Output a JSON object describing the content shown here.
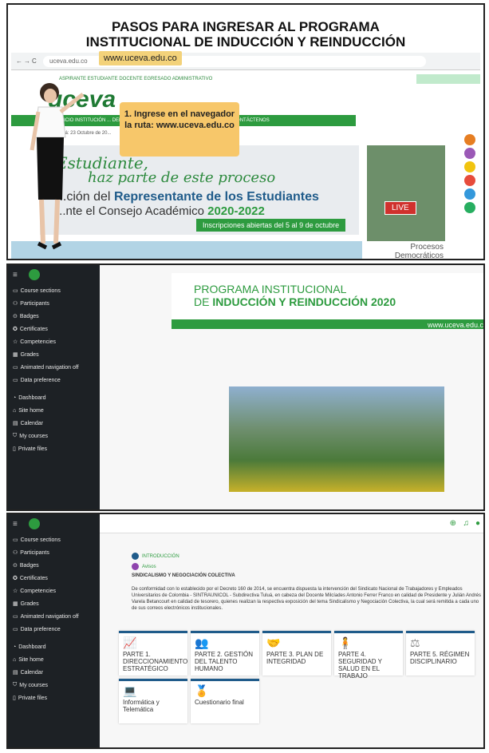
{
  "p1": {
    "title_line1": "PASOS PARA INGRESAR AL PROGRAMA",
    "title_line2": "INSTITUCIONAL DE  INDUCCIÓN Y REINDUCCIÓN",
    "url_small": "uceva.edu.co",
    "url_highlight": "www.uceva.edu.co",
    "top_links": "ASPIRANTE   ESTUDIANTE   DOCENTE   EGRESADO   ADMINISTRATIVO",
    "logo": "uceva",
    "nav_items": "INICIO   INSTITUCIÓN   ...   DEMOCRACIA   SERVICIOS   TRANSPARENCIA   PQRSD   CONTÁCTENOS",
    "callout": "1. Ingrese en el navegador la ruta: www.uceva.edu.co",
    "banner_script1": "Estudiante,",
    "banner_script2": "haz parte de este proceso",
    "banner_line1_a": "...ción del ",
    "banner_line1_b": "Representante de los Estudiantes",
    "banner_line2_a": "...nte el Consejo Académico ",
    "banner_line2_b": "2020-2022",
    "banner_inscr": "Inscripciones abiertas del 5 al 9 de octubre",
    "live": "LIVE",
    "procesos": "Procesos Democráticos",
    "date": "Tuluá: 23 Octubre de 20..."
  },
  "sidebar": {
    "items": [
      "Course sections",
      "Participants",
      "Badges",
      "Certificates",
      "Competencies",
      "Grades",
      "Animated navigation off",
      "Data preference",
      "Dashboard",
      "Site home",
      "Calendar",
      "My courses",
      "Private files"
    ]
  },
  "p2": {
    "title1": "PROGRAMA INSTITUCIONAL",
    "title2_a": "DE ",
    "title2_b": "INDUCCIÓN Y REINDUCCIÓN 2020",
    "site": "www.uceva.edu.co"
  },
  "p3": {
    "intro": "INTRODUCCIÓN",
    "avisos": "Avisos",
    "heading": "SINDICALISMO Y NEGOCIACIÓN COLECTIVA",
    "paragraph": "De conformidad con lo establecido por el Decreto 160 de 2014, se encuentra dispuesta la intervención del Sindicato Nacional de Trabajadores y Empleados Universitarios de Colombia - SINTRAUNICOL - Subdirectiva Tuluá, en cabeza del Docente Milcíades Antonio Ferrer Franco en calidad de Presidente y Julián Andrés Varela Betancourt en calidad de tesorero, quienes realizan la respectiva exposición del tema Sindicalismo y Negociación Colectiva, la cual será remitida a cada uno de sus correos electrónicos institucionales.",
    "tiles": [
      {
        "icon": "chart-icon",
        "glyph": "📈",
        "label": "PARTE 1. DIRECCIONAMIENTO ESTRATÉGICO"
      },
      {
        "icon": "people-icon",
        "glyph": "👥",
        "label": "PARTE 2. GESTIÓN DEL TALENTO HUMANO"
      },
      {
        "icon": "handshake-icon",
        "glyph": "🤝",
        "label": "PARTE 3. PLAN DE INTEGRIDAD"
      },
      {
        "icon": "worker-icon",
        "glyph": "🧍",
        "label": "PARTE 4. SEGURIDAD Y SALUD EN EL TRABAJO"
      },
      {
        "icon": "scales-icon",
        "glyph": "⚖",
        "label": "PARTE 5. RÉGIMEN DISCIPLINARIO"
      },
      {
        "icon": "laptop-icon",
        "glyph": "💻",
        "label": "Informática y Telemática"
      },
      {
        "icon": "award-icon",
        "glyph": "🏅",
        "label": "Cuestionario final"
      }
    ]
  },
  "colors": {
    "accent": "#2d9b3f",
    "sidebar": "#1d2125",
    "tile_border": "#1f5b8a"
  }
}
